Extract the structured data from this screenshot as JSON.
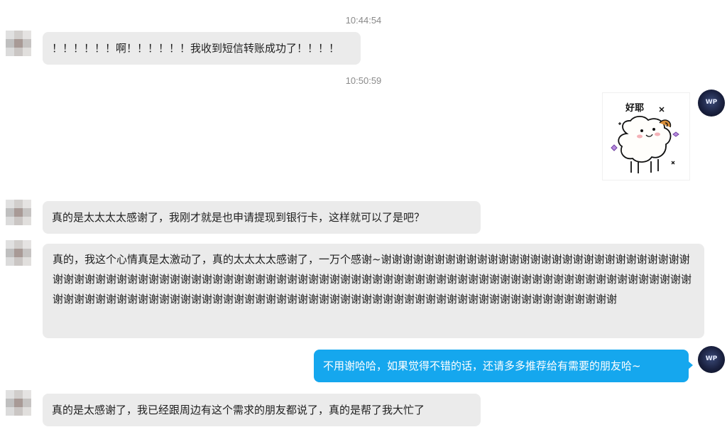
{
  "chat": {
    "timestamps": [
      "10:44:54",
      "10:50:59"
    ],
    "messages": [
      {
        "side": "left",
        "type": "text",
        "text": "！！！！！！啊！！！！！！我收到短信转账成功了！！！！"
      },
      {
        "side": "right",
        "type": "sticker",
        "sticker_text": "好耶"
      },
      {
        "side": "left",
        "type": "text",
        "text": "真的是太太太太感谢了，我刚才就是也申请提现到银行卡，这样就可以了是吧？"
      },
      {
        "side": "left",
        "type": "text",
        "text": "真的，我这个心情真是太激动了，真的太太太太感谢了，一万个感谢~谢谢谢谢谢谢谢谢谢谢谢谢谢谢谢谢谢谢谢谢谢谢谢谢谢谢谢谢谢谢谢谢谢谢谢谢谢谢谢谢谢谢谢谢谢谢谢谢谢谢谢谢谢谢谢谢谢谢谢谢谢谢谢谢谢谢谢谢谢谢谢谢谢谢谢谢谢谢谢谢谢谢谢谢谢谢谢谢谢谢谢谢谢谢谢谢谢谢谢谢谢谢谢谢谢谢谢谢谢谢谢谢谢谢谢谢谢谢谢谢谢谢谢谢谢谢谢谢谢谢谢谢谢谢谢谢谢谢谢谢谢谢"
      },
      {
        "side": "right",
        "type": "text",
        "text": "不用谢哈哈，如果觉得不错的话，还请多多推荐给有需要的朋友哈~"
      },
      {
        "side": "left",
        "type": "text",
        "text": "真的是太感谢了，我已经跟周边有这个需求的朋友都说了，真的是帮了我大忙了"
      }
    ]
  },
  "colors": {
    "left_bubble": "#ebebeb",
    "right_bubble": "#15a7ee",
    "timestamp": "#8a8a8a"
  },
  "icons": {
    "left_avatar": "blurred-user-avatar",
    "right_avatar": "brand-logo-avatar"
  }
}
